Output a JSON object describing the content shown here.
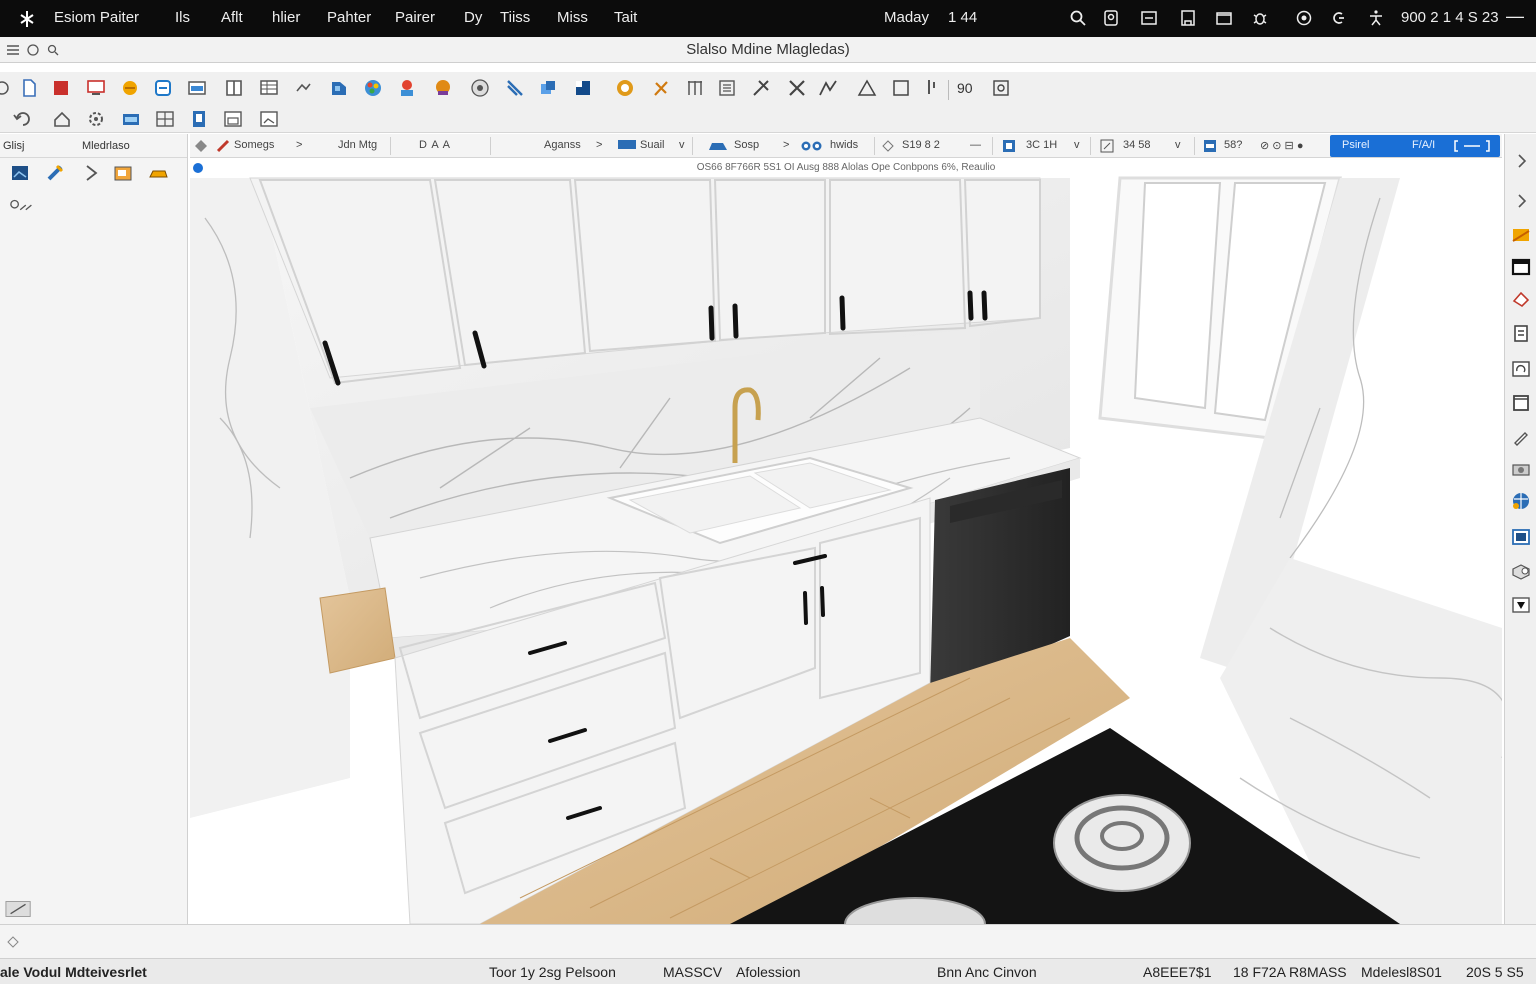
{
  "menubar": {
    "app_name": "Esiom Paiter",
    "items": [
      "Ils",
      "Aflt",
      "hlier",
      "Pahter",
      "Pairer",
      "Dy",
      "Tiiss",
      "Miss",
      "Tait"
    ],
    "center_label": "Maday",
    "center_value": "1 44",
    "clock": "900 2 1 4 S 23",
    "status_icons": [
      "search-icon",
      "person-icon",
      "window-icon",
      "tablet-icon",
      "folder-icon",
      "bug-icon",
      "record-icon",
      "wifi-icon",
      "accessibility-icon"
    ]
  },
  "window": {
    "title": "Slalso Mdine Mlagledas)"
  },
  "toolbar1": {
    "icons": [
      "select-icon",
      "new-file-icon",
      "material-icon",
      "monitor-icon",
      "sun-icon",
      "layer-icon",
      "display-icon",
      "book-icon",
      "table-icon",
      "cube-icon",
      "color-wheel-icon",
      "palette-icon",
      "light-bulb-icon",
      "sphere-icon",
      "brush-icon",
      "duplicate-icon",
      "frame-icon",
      "globe-icon",
      "pencil-icon",
      "grid-icon",
      "list-icon",
      "cut-icon",
      "cross-icon",
      "path-icon",
      "triangle-icon",
      "square-icon",
      "pipe-icon"
    ],
    "zoom": "90"
  },
  "toolbar2": {
    "icons": [
      "undo-icon",
      "home-icon",
      "settings-icon",
      "camera-icon",
      "grid-view-icon",
      "document-icon",
      "window-icon",
      "chart-icon"
    ]
  },
  "leftpanel": {
    "header_left": "Glisj",
    "header_right": "Mledrlaso",
    "item_icons": [
      "image-icon",
      "brush-icon",
      "arrow-icon",
      "folder-icon",
      "box-icon"
    ],
    "tool_icon": "snap-icon"
  },
  "optionsbar": {
    "items": [
      "Somegs",
      "Jdn Mtg",
      "D A A",
      "Aganss",
      "Suail",
      "Sosp",
      "hwids",
      "S19 8 2",
      "3C 1H",
      "34 58",
      "58?",
      "Psirel",
      "F/A/I"
    ]
  },
  "viewport": {
    "info": "OS66 8F766R 5S1 OI Ausg 888 Alolas Ope Conbpons 6%, Reaulio"
  },
  "rightbar": {
    "icons": [
      "chevron-right-icon",
      "chevron-right-icon",
      "paint-icon",
      "panel-icon",
      "eraser-icon",
      "paste-icon",
      "rotate-icon",
      "layer-icon",
      "pen-icon",
      "camera-icon",
      "globe-icon",
      "texture-icon",
      "box-icon",
      "shield-icon"
    ]
  },
  "statusbar": {
    "left": "ale Vodul Mdteivesrlet",
    "tool": "Toor 1y 2sg Pelsoon",
    "mode": "MASSCV",
    "mode_detail": "Afolession",
    "center": "Bnn Anc Cinvon",
    "coord1": "A8EEE7$1",
    "coord2": "18 F72A R8MASS",
    "coord3": "Mdelesl8S01",
    "coord4": "20S 5 S5"
  },
  "colors": {
    "accent": "#1a6fd6",
    "menubar": "#0c0c0c",
    "panel": "#f4f4f4"
  }
}
